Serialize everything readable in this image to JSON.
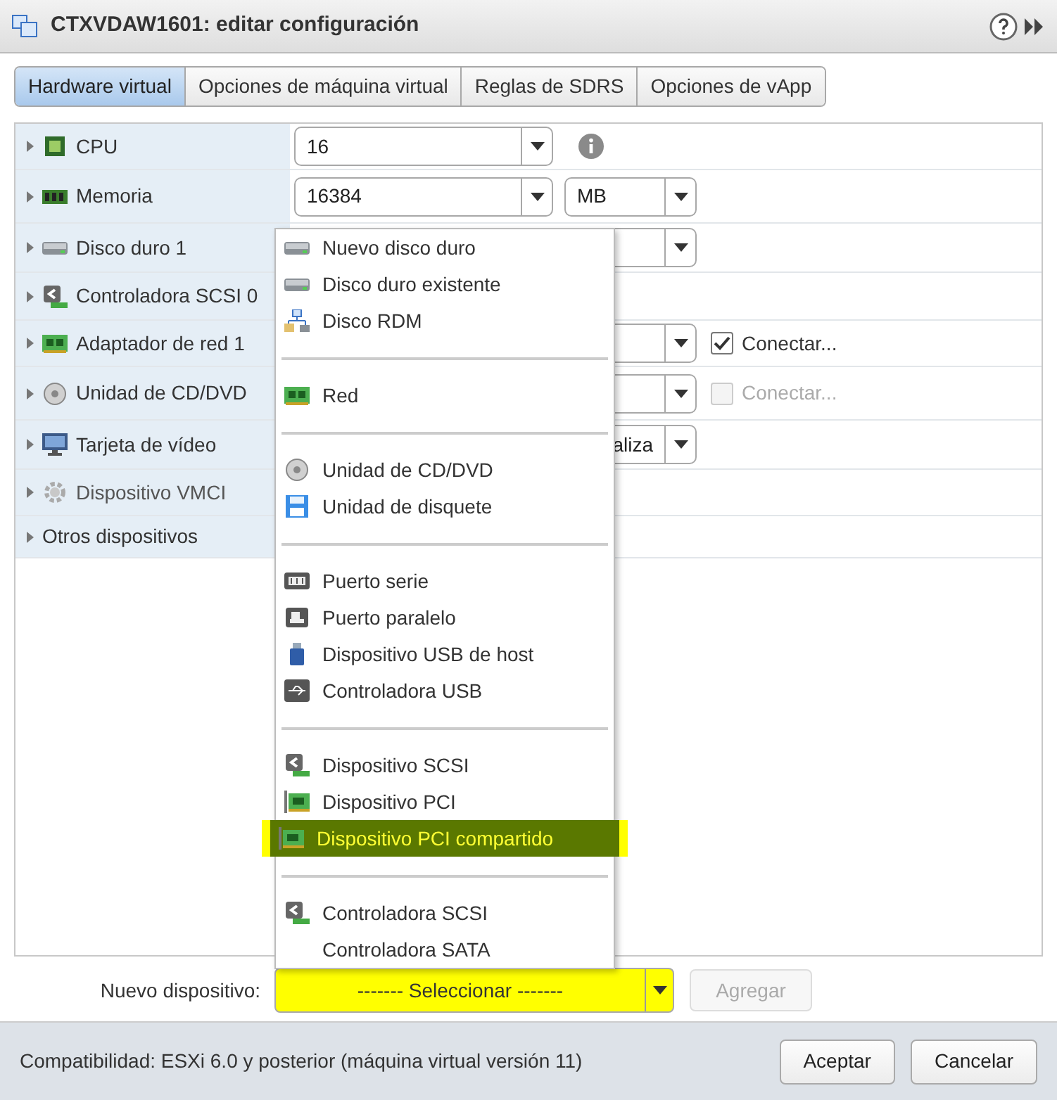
{
  "window": {
    "title": "CTXVDAW1601: editar configuración"
  },
  "tabs": [
    {
      "label": "Hardware virtual",
      "selected": true
    },
    {
      "label": "Opciones de máquina virtual",
      "selected": false
    },
    {
      "label": "Reglas de SDRS",
      "selected": false
    },
    {
      "label": "Opciones de vApp",
      "selected": false
    }
  ],
  "devices": [
    {
      "label": "CPU",
      "dropdown": true,
      "value": "16",
      "info": true
    },
    {
      "label": "Memoria",
      "dropdown": true,
      "value": "16384",
      "unit": "MB"
    },
    {
      "label": "Disco duro 1",
      "dropdown": true
    },
    {
      "label": "Controladora SCSI 0"
    },
    {
      "label": "Adaptador de red 1",
      "dropdown": true,
      "connect": {
        "label": "Conectar...",
        "checked": true,
        "disabled": false
      }
    },
    {
      "label": "Unidad de CD/DVD",
      "dropdown": true,
      "connect": {
        "label": "Conectar...",
        "checked": false,
        "disabled": true
      }
    },
    {
      "label": "Tarjeta de vídeo",
      "dropdown": true,
      "value": "aliza"
    },
    {
      "label": "Dispositivo VMCI"
    },
    {
      "label": "Otros dispositivos"
    }
  ],
  "menu": [
    [
      {
        "label": "Nuevo disco duro",
        "selected": false
      },
      {
        "label": "Disco duro existente",
        "selected": false
      },
      {
        "label": "Disco RDM",
        "selected": false
      }
    ],
    [
      {
        "label": "Red",
        "selected": false
      }
    ],
    [
      {
        "label": "Unidad de CD/DVD",
        "selected": false
      },
      {
        "label": "Unidad de disquete",
        "selected": false
      }
    ],
    [
      {
        "label": "Puerto serie",
        "selected": false
      },
      {
        "label": "Puerto paralelo",
        "selected": false
      },
      {
        "label": "Dispositivo USB de host",
        "selected": false
      },
      {
        "label": "Controladora USB",
        "selected": false
      }
    ],
    [
      {
        "label": "Dispositivo SCSI",
        "selected": false
      },
      {
        "label": "Dispositivo PCI",
        "selected": false
      },
      {
        "label": "Dispositivo PCI compartido",
        "selected": true
      }
    ],
    [
      {
        "label": "Controladora SCSI",
        "selected": false
      },
      {
        "label": "Controladora SATA",
        "selected": false
      }
    ]
  ],
  "new_device": {
    "label": "Nuevo dispositivo:",
    "value": "------- Seleccionar -------"
  },
  "add_button": {
    "label": "Agregar",
    "disabled": true
  },
  "footer": {
    "compatibility": "Compatibilidad: ESXi 6.0 y posterior (máquina virtual versión 11)",
    "buttons": [
      "Aceptar",
      "Cancelar"
    ]
  }
}
